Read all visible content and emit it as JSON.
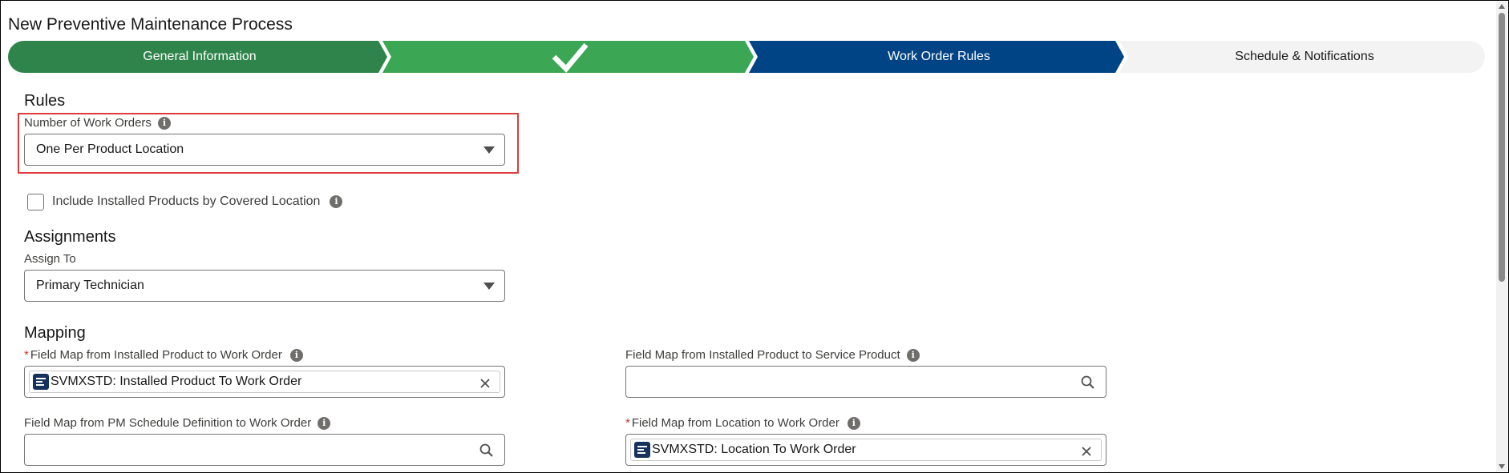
{
  "modal": {
    "title": "New Preventive Maintenance Process"
  },
  "path": {
    "steps": [
      {
        "label": "General Information",
        "state": "complete",
        "color": "#2e844a"
      },
      {
        "label": "",
        "state": "complete-checked",
        "color": "#3ba755",
        "icon": "check-icon"
      },
      {
        "label": "Work Order Rules",
        "state": "current",
        "color": "#014486"
      },
      {
        "label": "Schedule & Notifications",
        "state": "incomplete",
        "color": "#f3f3f3"
      }
    ]
  },
  "rules": {
    "title": "Rules",
    "number_of_work_orders": {
      "label": "Number of Work Orders",
      "value": "One Per Product Location"
    },
    "include_installed": {
      "label": "Include Installed Products by Covered Location",
      "checked": false
    }
  },
  "assignments": {
    "title": "Assignments",
    "assign_to": {
      "label": "Assign To",
      "value": "Primary Technician"
    }
  },
  "mapping": {
    "title": "Mapping",
    "ip_to_wo": {
      "label": "Field Map from Installed Product to Work Order",
      "required": true,
      "value": "SVMXSTD: Installed Product To Work Order"
    },
    "ip_to_sp": {
      "label": "Field Map from Installed Product to Service Product",
      "required": false,
      "value": ""
    },
    "pm_to_wo": {
      "label": "Field Map from PM Schedule Definition to Work Order",
      "required": false,
      "value": ""
    },
    "loc_to_wo": {
      "label": "Field Map from Location to Work Order",
      "required": true,
      "value": "SVMXSTD: Location To Work Order"
    }
  },
  "colors": {
    "highlight": "#e03b3b",
    "required": "#c23934"
  }
}
